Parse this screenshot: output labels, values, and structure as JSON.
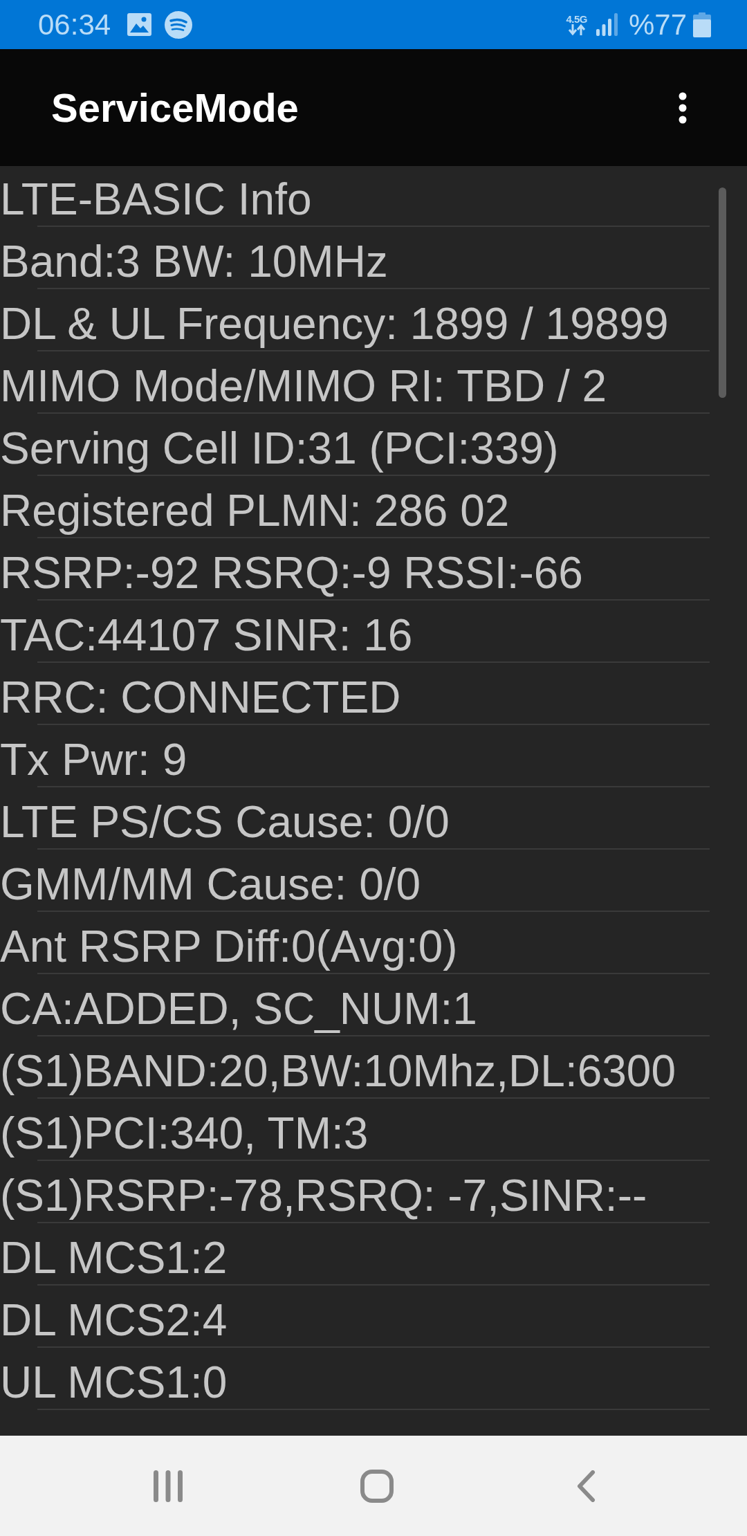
{
  "status_bar": {
    "time": "06:34",
    "network_type": "4.5G",
    "battery": "%77"
  },
  "app_bar": {
    "title": "ServiceMode"
  },
  "info_list": {
    "rows": [
      "LTE-BASIC Info",
      "Band:3 BW: 10MHz",
      "DL & UL Frequency: 1899 / 19899",
      "MIMO Mode/MIMO RI: TBD / 2",
      "Serving Cell ID:31 (PCI:339)",
      "Registered PLMN: 286 02",
      "RSRP:-92 RSRQ:-9 RSSI:-66",
      "TAC:44107 SINR: 16",
      "RRC: CONNECTED",
      "Tx Pwr: 9",
      "LTE PS/CS Cause: 0/0",
      "GMM/MM Cause: 0/0",
      "Ant RSRP Diff:0(Avg:0)",
      "CA:ADDED, SC_NUM:1",
      "(S1)BAND:20,BW:10Mhz,DL:6300",
      "(S1)PCI:340, TM:3",
      "(S1)RSRP:-78,RSRQ: -7,SINR:--",
      "DL MCS1:2",
      "DL MCS2:4",
      "UL MCS1:0"
    ]
  }
}
